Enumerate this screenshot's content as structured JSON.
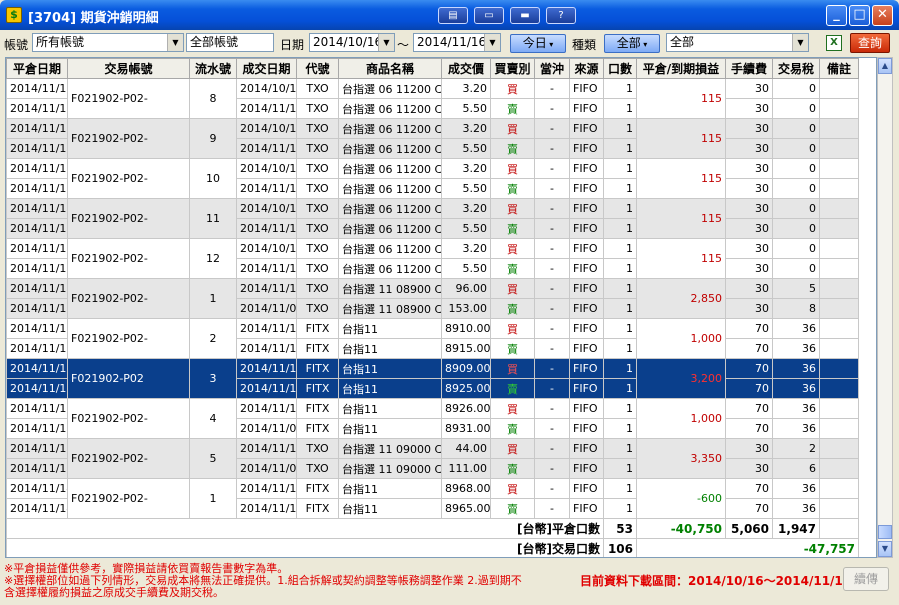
{
  "window": {
    "title": "[3704] 期貨沖銷明細",
    "tools": [
      "▤",
      "▭",
      "▬",
      "?"
    ],
    "controls": {
      "minimize": "_",
      "maximize": "□",
      "close": "✕"
    }
  },
  "toolbar": {
    "account_label": "帳號",
    "account_value": "所有帳號",
    "account_name": "全部帳號",
    "date_label": "日期",
    "date_from": "2014/10/16",
    "date_sep": "～",
    "date_to": "2014/11/16",
    "today_button": "今日",
    "type_label": "種類",
    "type_button": "全部",
    "type_value": "全部",
    "excel_icon": "excel-icon",
    "query_button": "查詢"
  },
  "table": {
    "columns": [
      "平倉日期",
      "交易帳號",
      "流水號",
      "成交日期",
      "代號",
      "商品名稱",
      "成交價",
      "買賣別",
      "當沖",
      "來源",
      "口數",
      "平倉/到期損益",
      "手續費",
      "交易稅",
      "備註"
    ],
    "groups": [
      {
        "close_date": [
          "2014/11/10",
          "2014/11/10"
        ],
        "account": "F021902-P02-",
        "seq": "8",
        "pl": "115",
        "pl_sign": "pos",
        "shade": false,
        "selected": false,
        "rows": [
          {
            "trade_date": "2014/10/17",
            "code": "TXO",
            "name": "台指選 06 11200 C",
            "price": "3.20",
            "side": "買",
            "daytrade": "-",
            "source": "FIFO",
            "qty": "1",
            "fee": "30",
            "tax": "0"
          },
          {
            "trade_date": "2014/11/10",
            "code": "TXO",
            "name": "台指選 06 11200 C",
            "price": "5.50",
            "side": "賣",
            "daytrade": "-",
            "source": "FIFO",
            "qty": "1",
            "fee": "30",
            "tax": "0"
          }
        ]
      },
      {
        "close_date": [
          "2014/11/10",
          "2014/11/10"
        ],
        "account": "F021902-P02-",
        "seq": "9",
        "pl": "115",
        "pl_sign": "pos",
        "shade": true,
        "selected": false,
        "rows": [
          {
            "trade_date": "2014/10/17",
            "code": "TXO",
            "name": "台指選 06 11200 C",
            "price": "3.20",
            "side": "買",
            "daytrade": "-",
            "source": "FIFO",
            "qty": "1",
            "fee": "30",
            "tax": "0"
          },
          {
            "trade_date": "2014/11/10",
            "code": "TXO",
            "name": "台指選 06 11200 C",
            "price": "5.50",
            "side": "賣",
            "daytrade": "-",
            "source": "FIFO",
            "qty": "1",
            "fee": "30",
            "tax": "0"
          }
        ]
      },
      {
        "close_date": [
          "2014/11/10",
          "2014/11/10"
        ],
        "account": "F021902-P02-",
        "seq": "10",
        "pl": "115",
        "pl_sign": "pos",
        "shade": false,
        "selected": false,
        "rows": [
          {
            "trade_date": "2014/10/17",
            "code": "TXO",
            "name": "台指選 06 11200 C",
            "price": "3.20",
            "side": "買",
            "daytrade": "-",
            "source": "FIFO",
            "qty": "1",
            "fee": "30",
            "tax": "0"
          },
          {
            "trade_date": "2014/11/10",
            "code": "TXO",
            "name": "台指選 06 11200 C",
            "price": "5.50",
            "side": "賣",
            "daytrade": "-",
            "source": "FIFO",
            "qty": "1",
            "fee": "30",
            "tax": "0"
          }
        ]
      },
      {
        "close_date": [
          "2014/11/10",
          "2014/11/10"
        ],
        "account": "F021902-P02-",
        "seq": "11",
        "pl": "115",
        "pl_sign": "pos",
        "shade": true,
        "selected": false,
        "rows": [
          {
            "trade_date": "2014/10/17",
            "code": "TXO",
            "name": "台指選 06 11200 C",
            "price": "3.20",
            "side": "買",
            "daytrade": "-",
            "source": "FIFO",
            "qty": "1",
            "fee": "30",
            "tax": "0"
          },
          {
            "trade_date": "2014/11/10",
            "code": "TXO",
            "name": "台指選 06 11200 C",
            "price": "5.50",
            "side": "賣",
            "daytrade": "-",
            "source": "FIFO",
            "qty": "1",
            "fee": "30",
            "tax": "0"
          }
        ]
      },
      {
        "close_date": [
          "2014/11/10",
          "2014/11/10"
        ],
        "account": "F021902-P02-",
        "seq": "12",
        "pl": "115",
        "pl_sign": "pos",
        "shade": false,
        "selected": false,
        "rows": [
          {
            "trade_date": "2014/10/17",
            "code": "TXO",
            "name": "台指選 06 11200 C",
            "price": "3.20",
            "side": "買",
            "daytrade": "-",
            "source": "FIFO",
            "qty": "1",
            "fee": "30",
            "tax": "0"
          },
          {
            "trade_date": "2014/11/10",
            "code": "TXO",
            "name": "台指選 06 11200 C",
            "price": "5.50",
            "side": "賣",
            "daytrade": "-",
            "source": "FIFO",
            "qty": "1",
            "fee": "30",
            "tax": "0"
          }
        ]
      },
      {
        "close_date": [
          "2014/11/12",
          "2014/11/12"
        ],
        "account": "F021902-P02-",
        "seq": "1",
        "pl": "2,850",
        "pl_sign": "pos",
        "shade": true,
        "selected": false,
        "rows": [
          {
            "trade_date": "2014/11/12",
            "code": "TXO",
            "name": "台指選 11 08900 C",
            "price": "96.00",
            "side": "買",
            "daytrade": "-",
            "source": "FIFO",
            "qty": "1",
            "fee": "30",
            "tax": "5"
          },
          {
            "trade_date": "2014/11/03",
            "code": "TXO",
            "name": "台指選 11 08900 C",
            "price": "153.00",
            "side": "賣",
            "daytrade": "-",
            "source": "FIFO",
            "qty": "1",
            "fee": "30",
            "tax": "8"
          }
        ]
      },
      {
        "close_date": [
          "2014/11/12",
          "2014/11/12"
        ],
        "account": "F021902-P02-",
        "seq": "2",
        "pl": "1,000",
        "pl_sign": "pos",
        "shade": false,
        "selected": false,
        "rows": [
          {
            "trade_date": "2014/11/12",
            "code": "FITX",
            "name": "台指11",
            "price": "8910.00",
            "side": "買",
            "daytrade": "-",
            "source": "FIFO",
            "qty": "1",
            "fee": "70",
            "tax": "36"
          },
          {
            "trade_date": "2014/11/12",
            "code": "FITX",
            "name": "台指11",
            "price": "8915.00",
            "side": "賣",
            "daytrade": "-",
            "source": "FIFO",
            "qty": "1",
            "fee": "70",
            "tax": "36"
          }
        ]
      },
      {
        "close_date": [
          "2014/11/12",
          "2014/11/12"
        ],
        "account": "F021902-P02",
        "seq": "3",
        "pl": "3,200",
        "pl_sign": "pos",
        "shade": false,
        "selected": true,
        "rows": [
          {
            "trade_date": "2014/11/12",
            "code": "FITX",
            "name": "台指11",
            "price": "8909.00",
            "side": "買",
            "daytrade": "-",
            "source": "FIFO",
            "qty": "1",
            "fee": "70",
            "tax": "36"
          },
          {
            "trade_date": "2014/11/12",
            "code": "FITX",
            "name": "台指11",
            "price": "8925.00",
            "side": "賣",
            "daytrade": "-",
            "source": "FIFO",
            "qty": "1",
            "fee": "70",
            "tax": "36"
          }
        ]
      },
      {
        "close_date": [
          "2014/11/12",
          "2014/11/12"
        ],
        "account": "F021902-P02-",
        "seq": "4",
        "pl": "1,000",
        "pl_sign": "pos",
        "shade": false,
        "selected": false,
        "rows": [
          {
            "trade_date": "2014/11/12",
            "code": "FITX",
            "name": "台指11",
            "price": "8926.00",
            "side": "買",
            "daytrade": "-",
            "source": "FIFO",
            "qty": "1",
            "fee": "70",
            "tax": "36"
          },
          {
            "trade_date": "2014/11/07",
            "code": "FITX",
            "name": "台指11",
            "price": "8931.00",
            "side": "賣",
            "daytrade": "-",
            "source": "FIFO",
            "qty": "1",
            "fee": "70",
            "tax": "36"
          }
        ]
      },
      {
        "close_date": [
          "2014/11/12",
          "2014/11/12"
        ],
        "account": "F021902-P02-",
        "seq": "5",
        "pl": "3,350",
        "pl_sign": "pos",
        "shade": true,
        "selected": false,
        "rows": [
          {
            "trade_date": "2014/11/12",
            "code": "TXO",
            "name": "台指選 11 09000 C",
            "price": "44.00",
            "side": "買",
            "daytrade": "-",
            "source": "FIFO",
            "qty": "1",
            "fee": "30",
            "tax": "2"
          },
          {
            "trade_date": "2014/11/03",
            "code": "TXO",
            "name": "台指選 11 09000 C",
            "price": "111.00",
            "side": "賣",
            "daytrade": "-",
            "source": "FIFO",
            "qty": "1",
            "fee": "30",
            "tax": "6"
          }
        ]
      },
      {
        "close_date": [
          "2014/11/14",
          "2014/11/14"
        ],
        "account": "F021902-P02-",
        "seq": "1",
        "pl": "-600",
        "pl_sign": "neg",
        "shade": false,
        "selected": false,
        "rows": [
          {
            "trade_date": "2014/11/14",
            "code": "FITX",
            "name": "台指11",
            "price": "8968.00",
            "side": "買",
            "daytrade": "-",
            "source": "FIFO",
            "qty": "1",
            "fee": "70",
            "tax": "36"
          },
          {
            "trade_date": "2014/11/14",
            "code": "FITX",
            "name": "台指11",
            "price": "8965.00",
            "side": "賣",
            "daytrade": "-",
            "source": "FIFO",
            "qty": "1",
            "fee": "70",
            "tax": "36"
          }
        ]
      }
    ],
    "summary": {
      "close_label": "[台幣]平倉口數",
      "close_qty": "53",
      "close_pl": "-40,750",
      "close_fee": "5,060",
      "close_tax": "1,947",
      "trade_label": "[台幣]交易口數",
      "trade_qty": "106",
      "trade_net": "-47,757"
    }
  },
  "footer": {
    "note1": "※平倉損益僅供參考，實際損益請依買賣報告書數字為準。",
    "note2": "※選擇權部位如過下列情形，交易成本將無法正確提供。1.組合拆解或契約調整等帳務調整作業 2.過到期不",
    "note3": "含選擇權履約損益之原成交手續費及期交稅。",
    "range_label": "目前資料下載區間：2014/10/16～2014/11/16",
    "continue_button": "續傳"
  },
  "colors": {
    "buy": "#c00000",
    "sell": "#008000",
    "selected_row": "#0a3f8c",
    "query_button": "#e04a1a",
    "title_bar": "#0a5ce0"
  }
}
